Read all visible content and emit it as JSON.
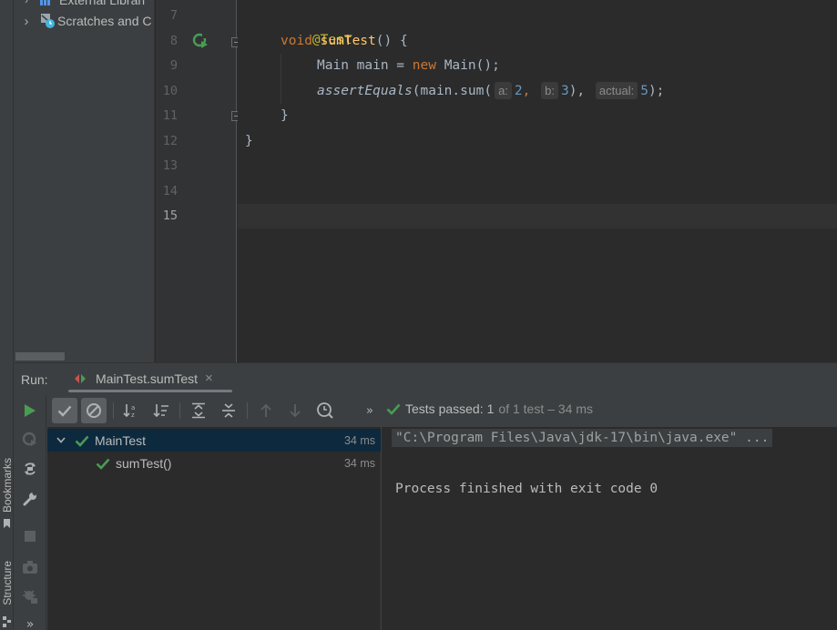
{
  "sidebar_tabs": {
    "bookmarks": "Bookmarks",
    "structure": "Structure"
  },
  "project_tree": {
    "items": [
      {
        "label": "External Librari"
      },
      {
        "label": "Scratches and C"
      }
    ]
  },
  "editor": {
    "line_numbers": [
      "7",
      "8",
      "9",
      "10",
      "11",
      "12",
      "13",
      "14",
      "15"
    ],
    "current_line": "15",
    "lines": {
      "l7": {
        "annotation": "@Test"
      },
      "l8": {
        "kw": "void",
        "name": "sumTest",
        "rest": "() {"
      },
      "l9": {
        "pre": "Main main = ",
        "kw": "new",
        "post": " Main();"
      },
      "l10": {
        "call": "assertEquals",
        "open": "(main.sum(",
        "hint_a": "a:",
        "val_a": "2",
        "comma1": ",",
        "hint_b": "b:",
        "val_b": "3",
        "close1": "),",
        "hint_actual": "actual:",
        "val_actual": "5",
        "close2": ");"
      },
      "l11": {
        "text": "}"
      },
      "l12": {
        "text": "}"
      }
    }
  },
  "run_window": {
    "title": "Run:",
    "tab_label": "MainTest.sumTest",
    "status": {
      "passed_label": "Tests passed:",
      "passed_count": "1",
      "of_text": "of 1 test",
      "duration": "– 34 ms"
    },
    "tree": [
      {
        "label": "MainTest",
        "time": "34 ms"
      },
      {
        "label": "sumTest()",
        "time": "34 ms"
      }
    ],
    "console": {
      "command": "\"C:\\Program Files\\Java\\jdk-17\\bin\\java.exe\" ...",
      "exit_message": "Process finished with exit code 0"
    }
  },
  "colors": {
    "pass_green": "#499c54",
    "keyword": "#cc7832",
    "annotation": "#bbb529",
    "function": "#ffc66d",
    "number": "#6897bb",
    "selection": "#0d293e"
  }
}
